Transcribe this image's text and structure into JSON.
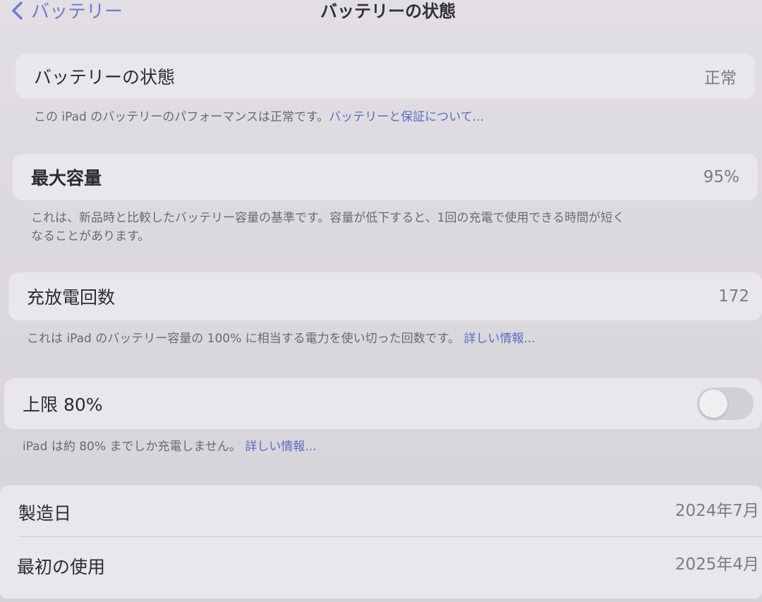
{
  "nav": {
    "back_label": "バッテリー",
    "title": "バッテリーの状態"
  },
  "health": {
    "label": "バッテリーの状態",
    "value": "正常",
    "footnote_text": "この iPad のバッテリーのパフォーマンスは正常です。",
    "footnote_link": "バッテリーと保証について..."
  },
  "capacity": {
    "label": "最大容量",
    "value": "95%",
    "footnote_line1": "これは、新品時と比較したバッテリー容量の基準です。容量が低下すると、1回の充電で使用できる時間が短く",
    "footnote_line2": "なることがあります。"
  },
  "cycles": {
    "label": "充放電回数",
    "value": "172",
    "footnote_text": "これは iPad のバッテリー容量の 100% に相当する電力を使い切った回数です。",
    "footnote_link": "詳しい情報..."
  },
  "limit": {
    "label": "上限 80%",
    "toggle_on": false,
    "footnote_text": "iPad は約 80% までしか充電しません。",
    "footnote_link": "詳しい情報..."
  },
  "dates": {
    "manufacture_label": "製造日",
    "manufacture_value": "2024年7月",
    "first_use_label": "最初の使用",
    "first_use_value": "2025年4月"
  },
  "colors": {
    "accent": "#5a6bc6",
    "background": "#dcd9de",
    "card": "#e9e7eb"
  },
  "icons": {
    "back": "chevron-left-icon"
  }
}
